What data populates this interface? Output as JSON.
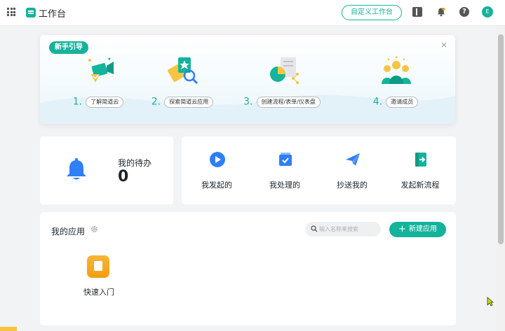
{
  "header": {
    "title": "工作台",
    "customize_label": "自定义工作台",
    "avatar_initial": "E"
  },
  "guide": {
    "badge": "新手引导",
    "close": "×",
    "steps": [
      {
        "num": "1.",
        "label": "了解简道云"
      },
      {
        "num": "2.",
        "label": "探索简道云应用"
      },
      {
        "num": "3.",
        "label": "创建流程/表单/仪表盘"
      },
      {
        "num": "4.",
        "label": "邀请成员"
      }
    ]
  },
  "todo": {
    "label": "我的待办",
    "count": "0"
  },
  "actions": [
    {
      "label": "我发起的",
      "icon": "play-icon"
    },
    {
      "label": "我处理的",
      "icon": "inbox-check-icon"
    },
    {
      "label": "抄送我的",
      "icon": "paper-plane-icon"
    },
    {
      "label": "发起新流程",
      "icon": "exit-door-icon"
    }
  ],
  "apps": {
    "title": "我的应用",
    "search_placeholder": "输入名称来搜索",
    "new_app_label": "新建应用",
    "items": [
      {
        "label": "快速入门"
      }
    ]
  },
  "colors": {
    "accent": "#14b39b",
    "blue": "#2f7ff5",
    "app_orange": "#f39c12"
  }
}
